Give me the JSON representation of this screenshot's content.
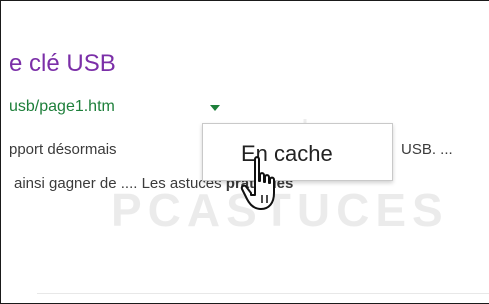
{
  "result": {
    "title": "e clé USB",
    "url": "usb/page1.htm",
    "snippet_line1_left": "pport désormais",
    "snippet_line1_right": "USB. ...",
    "snippet_line2_left": "ainsi gagner de .... Les astuces ",
    "snippet_line2_bold": "pratiques"
  },
  "context_menu": {
    "item_label": "En cache"
  },
  "watermark": "PCASTUCES",
  "colors": {
    "title": "#7b2fa8",
    "url": "#1d7f3a",
    "snippet": "#3b3b3b"
  },
  "icons": {
    "url_dropdown": "triangle-down-icon",
    "cursor": "hand-pointer-icon"
  }
}
